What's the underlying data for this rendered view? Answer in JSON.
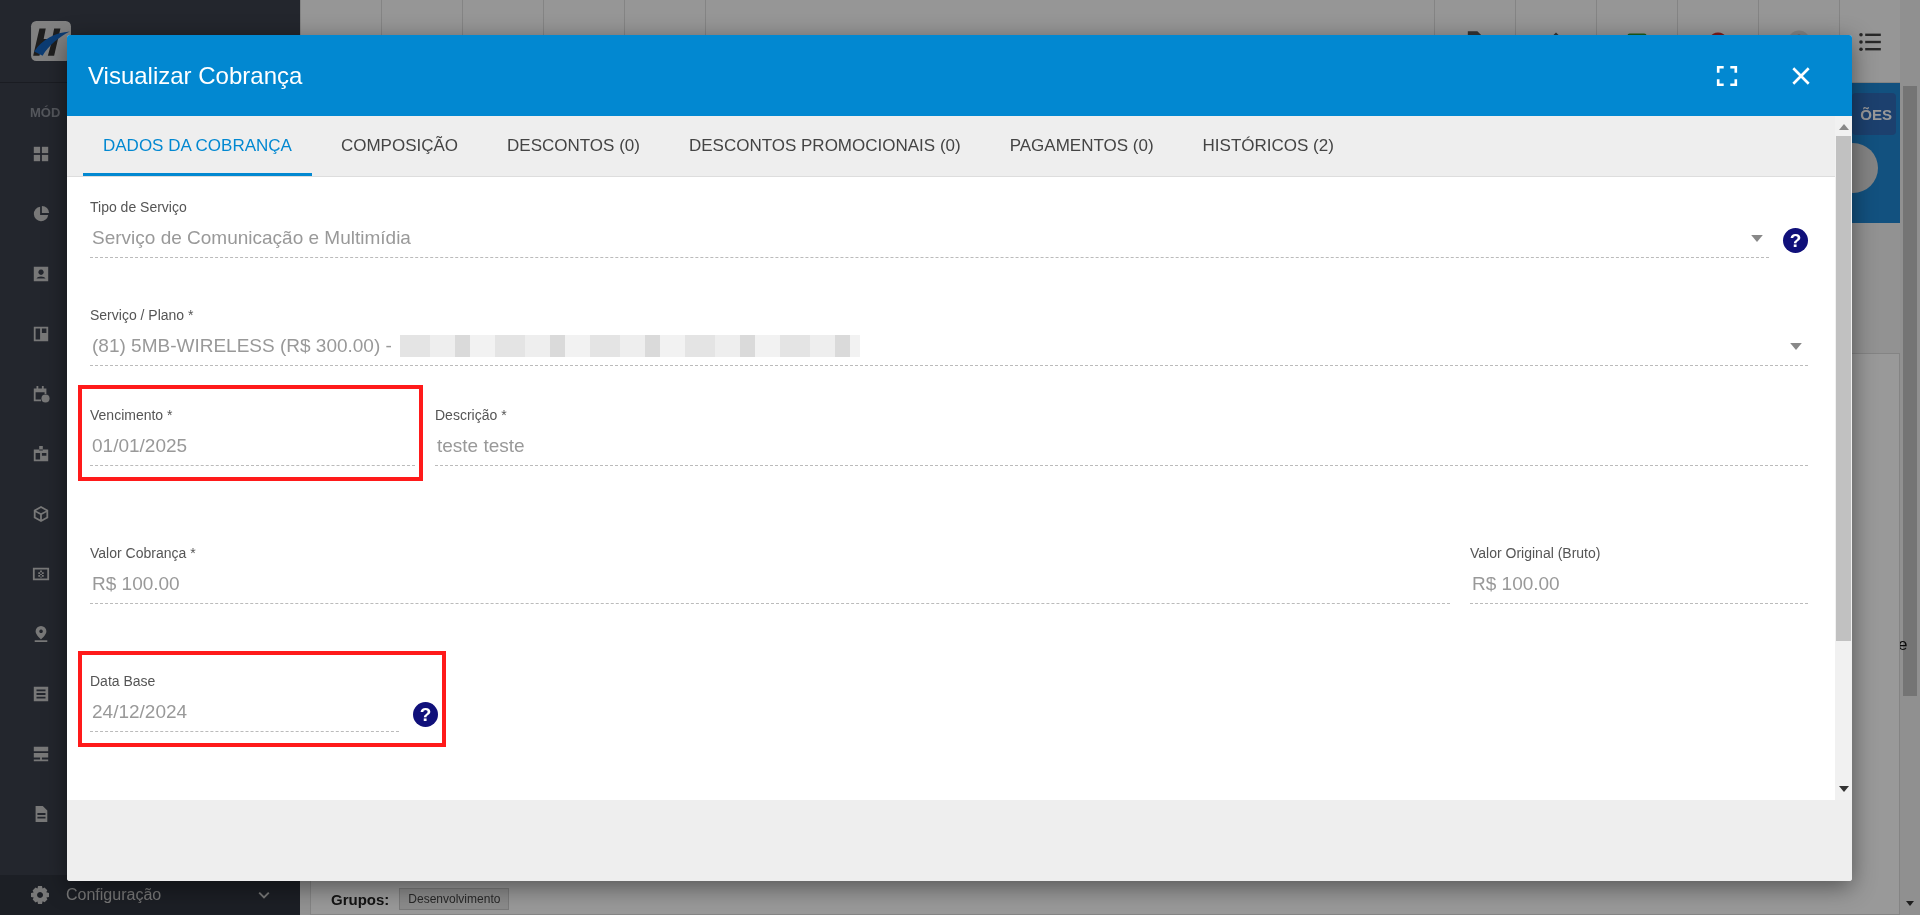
{
  "background": {
    "sidebar": {
      "section_label": "MÓD",
      "footer_item": "Configuração"
    },
    "side_button": "ÕES",
    "page_fragment": "e",
    "groups": {
      "label": "Grupos:",
      "tags": [
        "Desenvolvimento"
      ]
    }
  },
  "dialog": {
    "title": "Visualizar Cobrança",
    "tabs": [
      {
        "label": "DADOS DA COBRANÇA",
        "selected": true
      },
      {
        "label": "COMPOSIÇÃO",
        "selected": false
      },
      {
        "label": "DESCONTOS (0)",
        "selected": false
      },
      {
        "label": "DESCONTOS PROMOCIONAIS (0)",
        "selected": false
      },
      {
        "label": "PAGAMENTOS (0)",
        "selected": false
      },
      {
        "label": "HISTÓRICOS (2)",
        "selected": false
      }
    ],
    "rows": [
      [
        {
          "label": "Tipo de Serviço",
          "value": "Serviço de Comunicação e Multimídia",
          "kind": "select",
          "help": "?",
          "highlighted": false,
          "redacted": false
        }
      ],
      [
        {
          "label": "Serviço / Plano *",
          "value": "(81) 5MB-WIRELESS (R$ 300.00) -",
          "kind": "select",
          "highlighted": false,
          "redacted": true
        }
      ],
      [
        {
          "label": "Vencimento *",
          "value": "01/01/2025",
          "kind": "text",
          "highlighted": true,
          "redacted": false
        },
        {
          "label": "Descrição *",
          "value": "teste teste",
          "kind": "text",
          "highlighted": false,
          "redacted": false
        }
      ],
      [
        {
          "label": "Valor Cobrança *",
          "value": "R$ 100.00",
          "kind": "text",
          "highlighted": false,
          "redacted": false
        },
        {
          "label": "Valor Original (Bruto)",
          "value": "R$ 100.00",
          "kind": "text",
          "highlighted": false,
          "redacted": false
        }
      ],
      [
        {
          "label": "Data Base",
          "value": "24/12/2024",
          "kind": "text",
          "help": "?",
          "highlighted": true,
          "redacted": false
        }
      ]
    ]
  }
}
